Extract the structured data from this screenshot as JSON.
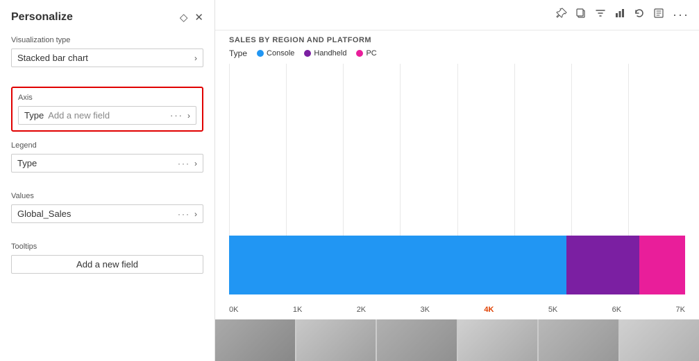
{
  "panel": {
    "title": "Personalize",
    "close_icon": "✕",
    "pin_icon": "◇",
    "visualization_type": {
      "label": "Visualization type",
      "value": "Stacked bar chart",
      "arrow": "›"
    },
    "axis": {
      "label": "Axis",
      "field_type": "Type",
      "field_placeholder": "Add a new field",
      "field_dots": "···",
      "field_arrow": "›"
    },
    "legend": {
      "label": "Legend",
      "value": "Type",
      "dots": "···",
      "arrow": "›"
    },
    "values": {
      "label": "Values",
      "value": "Global_Sales",
      "dots": "···",
      "arrow": "›"
    },
    "tooltips": {
      "label": "Tooltips",
      "add_field": "Add a new field"
    }
  },
  "chart": {
    "title": "SALES BY REGION AND PLATFORM",
    "legend_label": "Type",
    "legend_items": [
      {
        "label": "Console",
        "color": "#2196F3"
      },
      {
        "label": "Handheld",
        "color": "#7B1FA2"
      },
      {
        "label": "PC",
        "color": "#E91E9A"
      }
    ],
    "bar_segments": [
      {
        "label": "Console",
        "color": "#2196F3",
        "width_pct": 74
      },
      {
        "label": "Handheld",
        "color": "#7B1FA2",
        "width_pct": 16
      },
      {
        "label": "PC",
        "color": "#E91E9A",
        "width_pct": 10
      }
    ],
    "x_labels": [
      "0K",
      "1K",
      "2K",
      "3K",
      "4K",
      "5K",
      "6K",
      "7K"
    ],
    "x_highlight_index": 4,
    "toolbar_icons": [
      "📌",
      "📋",
      "🔽",
      "📊",
      "↩",
      "⬜",
      "···"
    ]
  }
}
